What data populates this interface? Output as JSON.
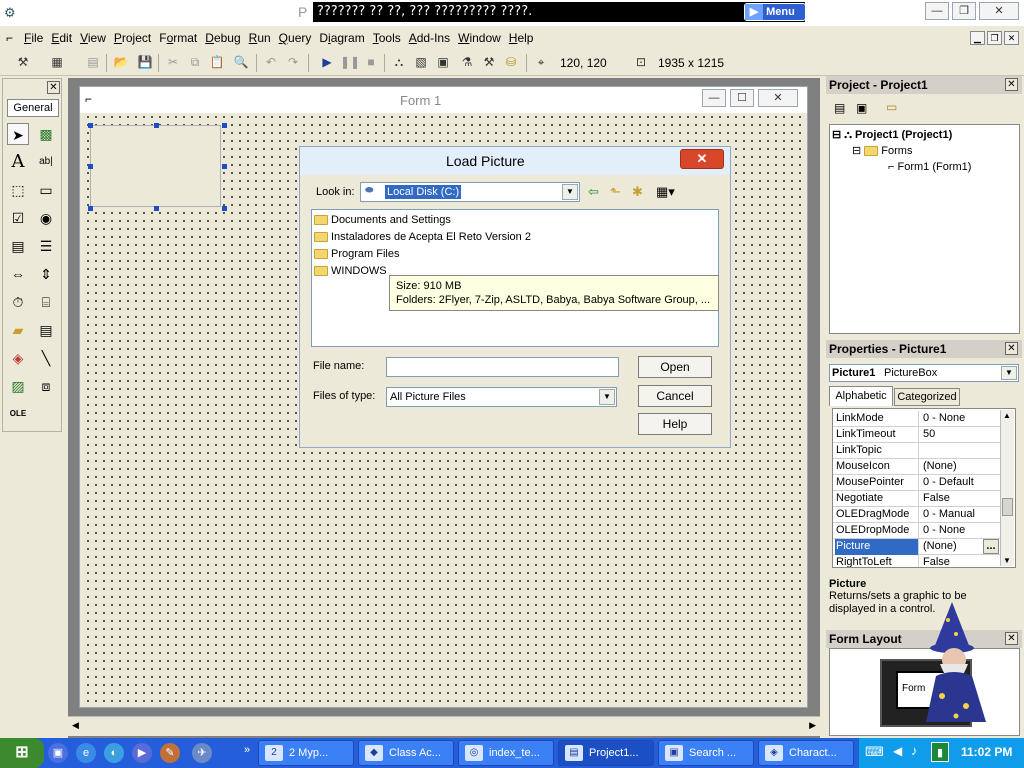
{
  "window": {
    "title_prefix": "P",
    "title_overlay": "??????? ?? ??, ??? ????????? ????.",
    "menu_pill_label": "Menu"
  },
  "menubar": {
    "items": [
      {
        "label": "File",
        "ul": "F",
        "rest": "ile"
      },
      {
        "label": "Edit",
        "ul": "E",
        "rest": "dit"
      },
      {
        "label": "View",
        "ul": "V",
        "rest": "iew"
      },
      {
        "label": "Project",
        "ul": "P",
        "rest": "roject"
      },
      {
        "label": "Format",
        "ul": "o",
        "pre": "F",
        "rest": "rmat"
      },
      {
        "label": "Debug",
        "ul": "D",
        "rest": "ebug"
      },
      {
        "label": "Run",
        "ul": "R",
        "rest": "un"
      },
      {
        "label": "Query",
        "ul": "Q",
        "rest": "uery"
      },
      {
        "label": "Diagram",
        "ul": "i",
        "pre": "D",
        "rest": "agram"
      },
      {
        "label": "Tools",
        "ul": "T",
        "rest": "ools"
      },
      {
        "label": "Add-Ins",
        "ul": "A",
        "rest": "dd-Ins"
      },
      {
        "label": "Window",
        "ul": "W",
        "rest": "indow"
      },
      {
        "label": "Help",
        "ul": "H",
        "rest": "elp"
      }
    ]
  },
  "toolbar": {
    "position_readout": "120, 120",
    "size_readout": "1935 x 1215"
  },
  "toolbox": {
    "tab_label": "General"
  },
  "form1": {
    "title": "Form 1"
  },
  "dialog": {
    "title": "Load Picture",
    "look_in_label": "Look in:",
    "look_in_value": "Local Disk (C:)",
    "folders": [
      "Documents and Settings",
      "Instaladores de Acepta El Reto Version 2",
      "Program Files",
      "WINDOWS"
    ],
    "tooltip_line1": "Size: 910 MB",
    "tooltip_line2": "Folders: 2Flyer, 7-Zip, ASLTD, Babya, Babya Software Group, ...",
    "file_name_label": "File name:",
    "file_name_value": "",
    "files_of_type_label": "Files of type:",
    "files_of_type_value": "All Picture Files",
    "open_label": "Open",
    "cancel_label": "Cancel",
    "help_label": "Help"
  },
  "project_panel": {
    "title": "Project - Project1",
    "root": "Project1 (Project1)",
    "folder": "Forms",
    "form": "Form1 (Form1)"
  },
  "properties_panel": {
    "title": "Properties - Picture1",
    "object_name": "Picture1",
    "object_type": "PictureBox",
    "tab_alphabetic": "Alphabetic",
    "tab_categorized": "Categorized",
    "rows": [
      {
        "key": "LinkMode",
        "value": "0 - None"
      },
      {
        "key": "LinkTimeout",
        "value": "50"
      },
      {
        "key": "LinkTopic",
        "value": ""
      },
      {
        "key": "MouseIcon",
        "value": "(None)"
      },
      {
        "key": "MousePointer",
        "value": "0 - Default"
      },
      {
        "key": "Negotiate",
        "value": "False"
      },
      {
        "key": "OLEDragMode",
        "value": "0 - Manual"
      },
      {
        "key": "OLEDropMode",
        "value": "0 - None"
      },
      {
        "key": "Picture",
        "value": "(None)"
      },
      {
        "key": "RightToLeft",
        "value": "False"
      }
    ],
    "ellipsis": "...",
    "desc_title": "Picture",
    "desc_text": "Returns/sets a graphic to be displayed in a control."
  },
  "form_layout_panel": {
    "title": "Form Layout",
    "preview_label": "Form"
  },
  "taskbar": {
    "tasks": [
      {
        "label": "2 Myp...",
        "icon": "2"
      },
      {
        "label": "Class Ac...",
        "icon": "◆"
      },
      {
        "label": "index_te...",
        "icon": "◎"
      },
      {
        "label": "Project1...",
        "icon": "▤"
      },
      {
        "label": "Search ...",
        "icon": "▣"
      },
      {
        "label": "Charact...",
        "icon": "◈"
      }
    ],
    "clock": "11:02 PM"
  }
}
